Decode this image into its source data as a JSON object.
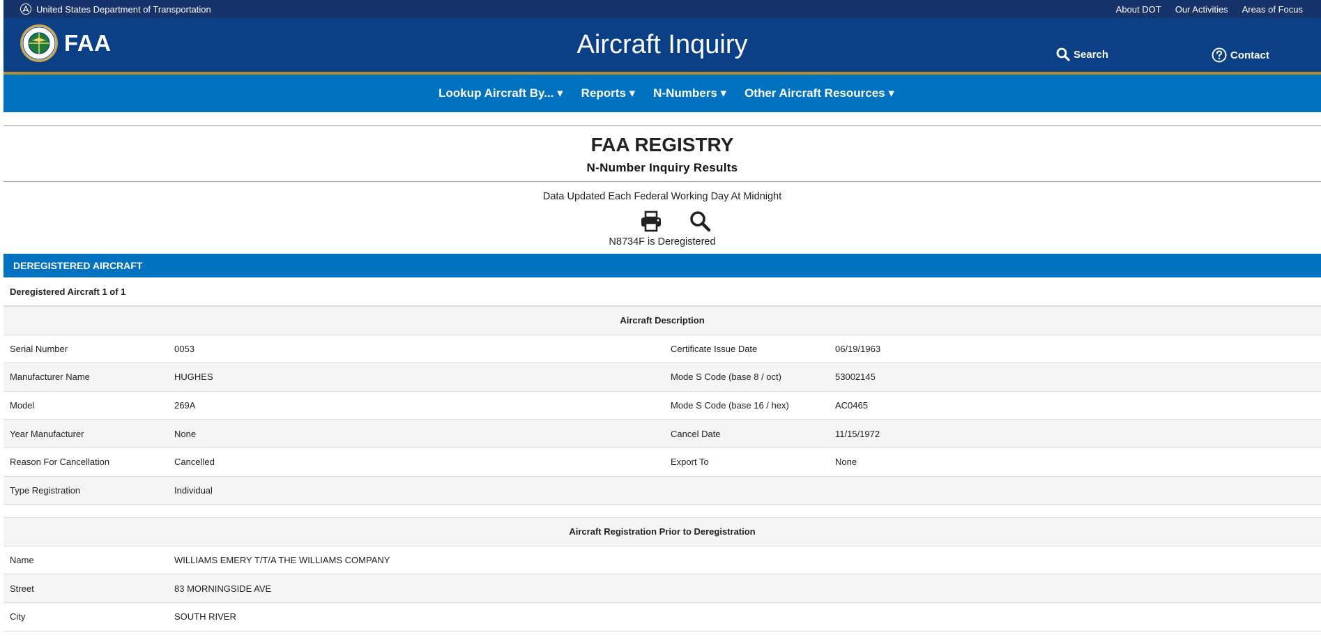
{
  "dot_bar": {
    "agency": "United States Department of Transportation",
    "links": [
      "About DOT",
      "Our Activities",
      "Areas of Focus"
    ]
  },
  "header": {
    "logo_text": "FAA",
    "title": "Aircraft Inquiry",
    "search_label": "Search",
    "contact_label": "Contact"
  },
  "nav": {
    "items": [
      "Lookup Aircraft By... ▾",
      "Reports ▾",
      "N-Numbers ▾",
      "Other Aircraft Resources ▾"
    ]
  },
  "registry": {
    "title": "FAA REGISTRY",
    "subtitle": "N-Number Inquiry Results",
    "updated": "Data Updated Each Federal Working Day At Midnight",
    "status": "N8734F is Deregistered"
  },
  "section": {
    "title": "DEREGISTERED AIRCRAFT",
    "count_label": "Deregistered Aircraft 1 of 1"
  },
  "aircraft_description": {
    "caption": "Aircraft Description",
    "rows": [
      {
        "l1": "Serial Number",
        "v1": "0053",
        "l2": "Certificate Issue Date",
        "v2": "06/19/1963"
      },
      {
        "l1": "Manufacturer Name",
        "v1": "HUGHES",
        "l2": "Mode S Code (base 8 / oct)",
        "v2": "53002145"
      },
      {
        "l1": "Model",
        "v1": "269A",
        "l2": "Mode S Code (base 16 / hex)",
        "v2": "AC0465"
      },
      {
        "l1": "Year Manufacturer",
        "v1": "None",
        "l2": "Cancel Date",
        "v2": "11/15/1972"
      },
      {
        "l1": "Reason For Cancellation",
        "v1": "Cancelled",
        "l2": "Export To",
        "v2": "None"
      },
      {
        "l1": "Type Registration",
        "v1": "Individual",
        "l2": "",
        "v2": ""
      }
    ]
  },
  "prior_registration": {
    "caption": "Aircraft Registration Prior to Deregistration",
    "rows": [
      {
        "label": "Name",
        "value": "WILLIAMS EMERY T/T/A THE WILLIAMS COMPANY"
      },
      {
        "label": "Street",
        "value": "83 MORNINGSIDE AVE"
      },
      {
        "label": "City",
        "value": "SOUTH RIVER"
      }
    ]
  },
  "colors": {
    "dot_bar": "#17336b",
    "header": "#0b3f86",
    "gold_rule": "#b38e35",
    "nav": "#0172c0",
    "section_bar": "#0172c0"
  },
  "icons": [
    "dot-seal-icon",
    "faa-seal-icon",
    "search-icon",
    "question-circle-icon",
    "print-icon",
    "magnifier-icon"
  ]
}
